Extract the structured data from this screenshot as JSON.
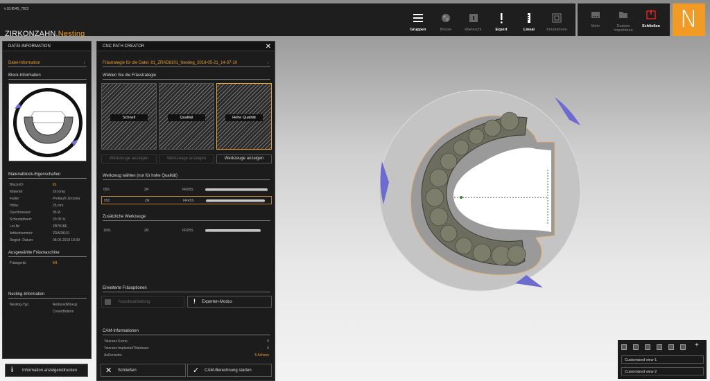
{
  "app": {
    "version": "v.18.8545_7822",
    "brand_main": "ZIRKONZAHN.",
    "brand_accent": "Nesting",
    "logo_letter": "N"
  },
  "toolbar": {
    "items": [
      {
        "label": "Gruppen",
        "icon": "list-icon",
        "enabled": true
      },
      {
        "label": "Blöcke",
        "icon": "blocks-icon",
        "enabled": false
      },
      {
        "label": "Warteschl.",
        "icon": "queue-icon",
        "enabled": false
      },
      {
        "label": "Expert",
        "icon": "exclamation-icon",
        "enabled": true
      },
      {
        "label": "Lineal",
        "icon": "ruler-icon",
        "enabled": true
      },
      {
        "label": "Fräsbahnen",
        "icon": "toolpath-icon",
        "enabled": false
      }
    ],
    "right_items": [
      {
        "label": "Mehr",
        "icon": "more-icon",
        "enabled": false
      },
      {
        "label": "Dateien importieren",
        "icon": "folder-icon",
        "enabled": false
      },
      {
        "label": "Schließen",
        "icon": "power-icon",
        "enabled": true
      }
    ]
  },
  "left_panel": {
    "header": "DATEI-INFORMATION",
    "section_datei": "Datei-Information",
    "section_block": "Block-Information",
    "section_props": "Materialblock-Eigenschaften",
    "props": [
      {
        "k": "Block-ID:",
        "v": "81",
        "accent": true
      },
      {
        "k": "Material:",
        "v": "Zirconia",
        "accent": false
      },
      {
        "k": "Farbe:",
        "v": "Prettau® Zirconia",
        "accent": false
      },
      {
        "k": "Höhe:",
        "v": "25 mm",
        "accent": false
      },
      {
        "k": "Durchmesser:",
        "v": "95 Ø",
        "accent": false
      },
      {
        "k": "Schrumpfwert:",
        "v": "20.05 %",
        "accent": false
      },
      {
        "k": "Lot-Nr:",
        "v": "ZB7818E",
        "accent": false
      },
      {
        "k": "Artikelnummer:",
        "v": "ZRAD8101",
        "accent": false
      },
      {
        "k": "Registr. Datum:",
        "v": "08.05.2018 10:39",
        "accent": false
      }
    ],
    "section_machine": "Ausgewählte Fräsmaschine",
    "machine_key": "Frästgerät:",
    "machine_value": "M1",
    "section_nesting": "Nesting-Information",
    "nesting_key": "Nesting-Typ:",
    "nesting_value1": "ReducedWaxup",
    "nesting_value2": "CrownBottom",
    "print_button": "Information anzeigen/drucken"
  },
  "cnc_panel": {
    "header": "CNC PATH CREATOR",
    "file_line": "Frästrategie für die Datei: 81_ZRAD8101_Nesting_2018-05-21_14-37-10",
    "choose_strategy": "Wählen Sie die Frässtrategie",
    "strategies": [
      {
        "label": "Schnell",
        "tools_btn": "Werkzeuge anzeigen",
        "selected": false
      },
      {
        "label": "Qualität",
        "tools_btn": "Werkzeuge anzeigen",
        "selected": false
      },
      {
        "label": "Hohe Qualität",
        "tools_btn": "Werkzeuge anzeigen",
        "selected": true
      }
    ],
    "choose_tool": "Werkzeug wählen (nur für hohe Qualität)",
    "tools": [
      {
        "a": "05S",
        "b": "ZR",
        "c": "FR05S",
        "selected": false
      },
      {
        "a": "05C",
        "b": "ZR",
        "c": "FR45S",
        "selected": true
      }
    ],
    "additional_tools": "Zusätzliche Werkzeuge",
    "extra_tools": [
      {
        "a": "15XL",
        "b": "ZR",
        "c": "FR25S"
      }
    ],
    "extended_options": "Erweiterte Fräsoptionen",
    "wet_button": "Nassbearbeitung",
    "expert_button": "Experten-Modus",
    "cam_info": "CAM-Informationen",
    "cam_rows": [
      {
        "k": "Toleranz Krone:",
        "v": "0"
      },
      {
        "k": "Toleranz Implantat/Titanbase:",
        "v": "0"
      },
      {
        "k": "Außenseite:",
        "v": "5 Achsen"
      }
    ],
    "close_button": "Schließen",
    "start_button": "CAM-Berechnung starten"
  },
  "viewbox": {
    "views": [
      "Customized view 1",
      "Customized view 2"
    ]
  },
  "colors": {
    "accent": "#f0a030",
    "logo_bg": "#f19a24",
    "panel_bg": "#1c1c1c"
  }
}
